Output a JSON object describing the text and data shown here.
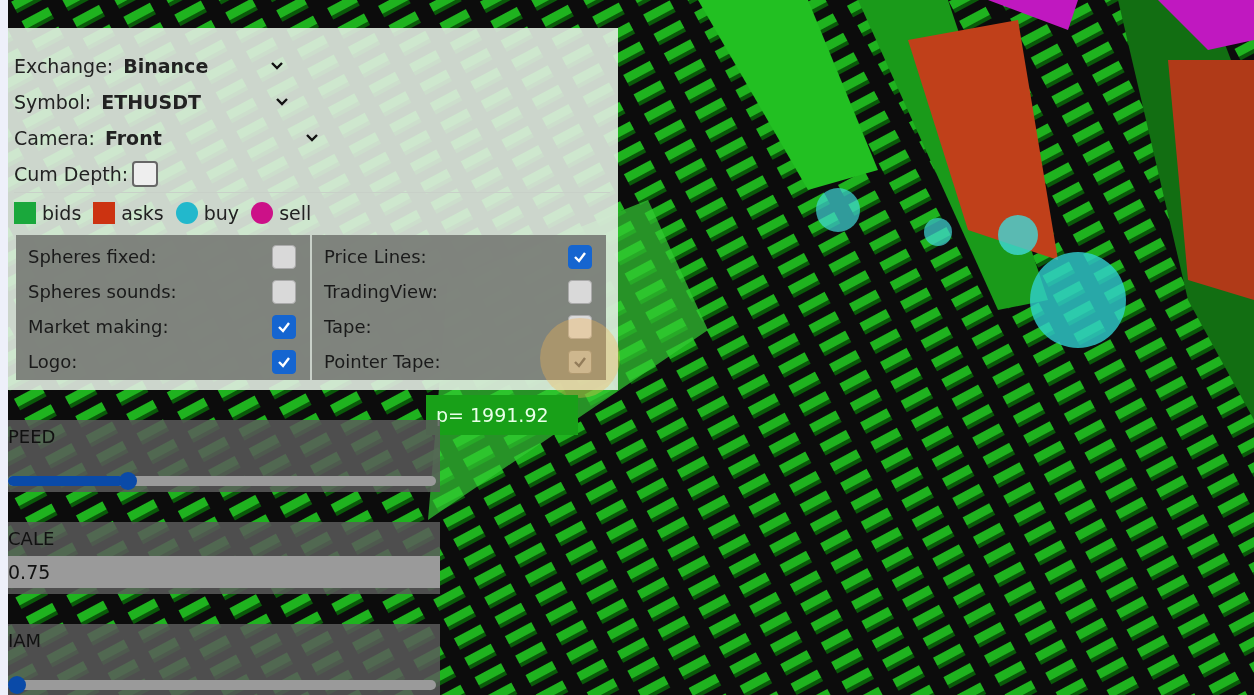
{
  "dropdowns": [
    {
      "label": "Exchange:",
      "value": "Binance"
    },
    {
      "label": "Symbol:",
      "value": "ETHUSDT"
    },
    {
      "label": "Camera:",
      "value": "Front"
    }
  ],
  "cum_depth": {
    "label": "Cum Depth:",
    "checked": false
  },
  "legend": [
    {
      "label": "bids",
      "kind": "square",
      "color": "#1aa83c"
    },
    {
      "label": "asks",
      "kind": "square",
      "color": "#cc3311"
    },
    {
      "label": "buy",
      "kind": "circle",
      "color": "#22b8cc"
    },
    {
      "label": "sell",
      "kind": "circle",
      "color": "#cc1188"
    }
  ],
  "options_left": [
    {
      "label": "Spheres fixed:",
      "checked": false,
      "disabled": false
    },
    {
      "label": "Spheres sounds:",
      "checked": false,
      "disabled": false
    },
    {
      "label": "Market making:",
      "checked": true,
      "disabled": false
    },
    {
      "label": "Logo:",
      "checked": true,
      "disabled": false
    }
  ],
  "options_right": [
    {
      "label": "Price Lines:",
      "checked": true,
      "disabled": false
    },
    {
      "label": "TradingView:",
      "checked": false,
      "disabled": false
    },
    {
      "label": "Tape:",
      "checked": false,
      "disabled": false
    },
    {
      "label": "Pointer Tape:",
      "checked": true,
      "disabled": true
    }
  ],
  "price_label": "p=  1991.92",
  "controls": [
    {
      "label": "PEED",
      "kind": "slider",
      "level": 0.27
    },
    {
      "label": "CALE",
      "kind": "field",
      "value": "0.75"
    },
    {
      "label": "IAM",
      "kind": "slider",
      "level": 0.0
    }
  ]
}
